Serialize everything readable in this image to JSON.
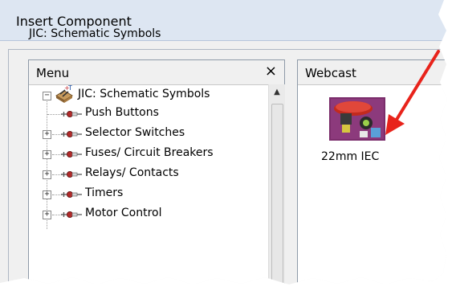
{
  "dialog": {
    "title": "Insert Component"
  },
  "path_label": "JIC: Schematic Symbols",
  "menu": {
    "title": "Menu",
    "close_glyph": "×",
    "root": {
      "label": "JIC: Schematic Symbols",
      "expander": "−",
      "icon": "schematic-library-icon"
    },
    "items": [
      {
        "label": "Push Buttons",
        "expandable": false
      },
      {
        "label": "Selector Switches",
        "expandable": true
      },
      {
        "label": "Fuses/ Circuit Breakers",
        "expandable": true
      },
      {
        "label": "Relays/ Contacts",
        "expandable": true
      },
      {
        "label": "Timers",
        "expandable": true
      },
      {
        "label": "Motor Control",
        "expandable": true
      }
    ],
    "expander_plus": "+"
  },
  "webcast": {
    "title": "Webcast",
    "item": {
      "label": "22mm IEC",
      "icon": "push-button-thumbnail"
    }
  },
  "colors": {
    "arrow": "#e8231b",
    "titlebar": "#dde6f2",
    "panel_border": "#8e9aa8"
  }
}
